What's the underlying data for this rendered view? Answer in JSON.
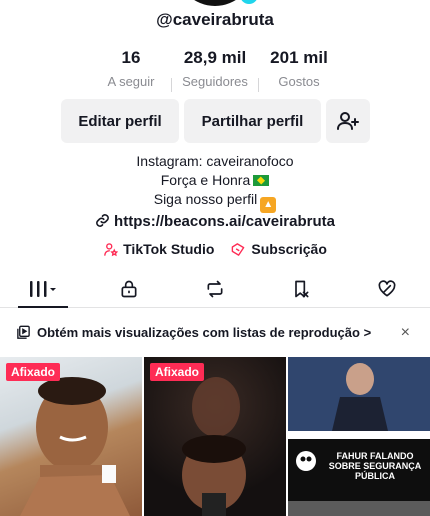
{
  "profile": {
    "username": "@caveirabruta",
    "stats": [
      {
        "value": "16",
        "label": "A seguir"
      },
      {
        "value": "28,9 mil",
        "label": "Seguidores"
      },
      {
        "value": "201 mil",
        "label": "Gostos"
      }
    ]
  },
  "actions": {
    "edit_label": "Editar perfil",
    "share_label": "Partilhar perfil",
    "add_friend_icon": "person-plus-icon"
  },
  "bio": {
    "line1": "Instagram: caveiranofoco",
    "line2": "Força e Honra",
    "line3": "Siga nosso perfil",
    "link": "https://beacons.ai/caveirabruta"
  },
  "links": {
    "studio": "TikTok Studio",
    "subscription": "Subscrição"
  },
  "tabs": [
    {
      "icon": "grid-icon",
      "active": true
    },
    {
      "icon": "lock-icon"
    },
    {
      "icon": "repost-icon"
    },
    {
      "icon": "bookmark-icon"
    },
    {
      "icon": "liked-icon"
    }
  ],
  "promo": {
    "text": "Obtém mais visualizações com listas de reprodução >",
    "close": "×"
  },
  "videos": [
    {
      "badge": "Afixado"
    },
    {
      "badge": "Afixado"
    },
    {
      "overlay": "FAHUR FALANDO SOBRE SEGURANÇA PÚBLICA"
    }
  ],
  "colors": {
    "accent": "#fe2c55",
    "text": "#161823",
    "muted": "#8a8b91",
    "button_bg": "#f1f1f2"
  }
}
